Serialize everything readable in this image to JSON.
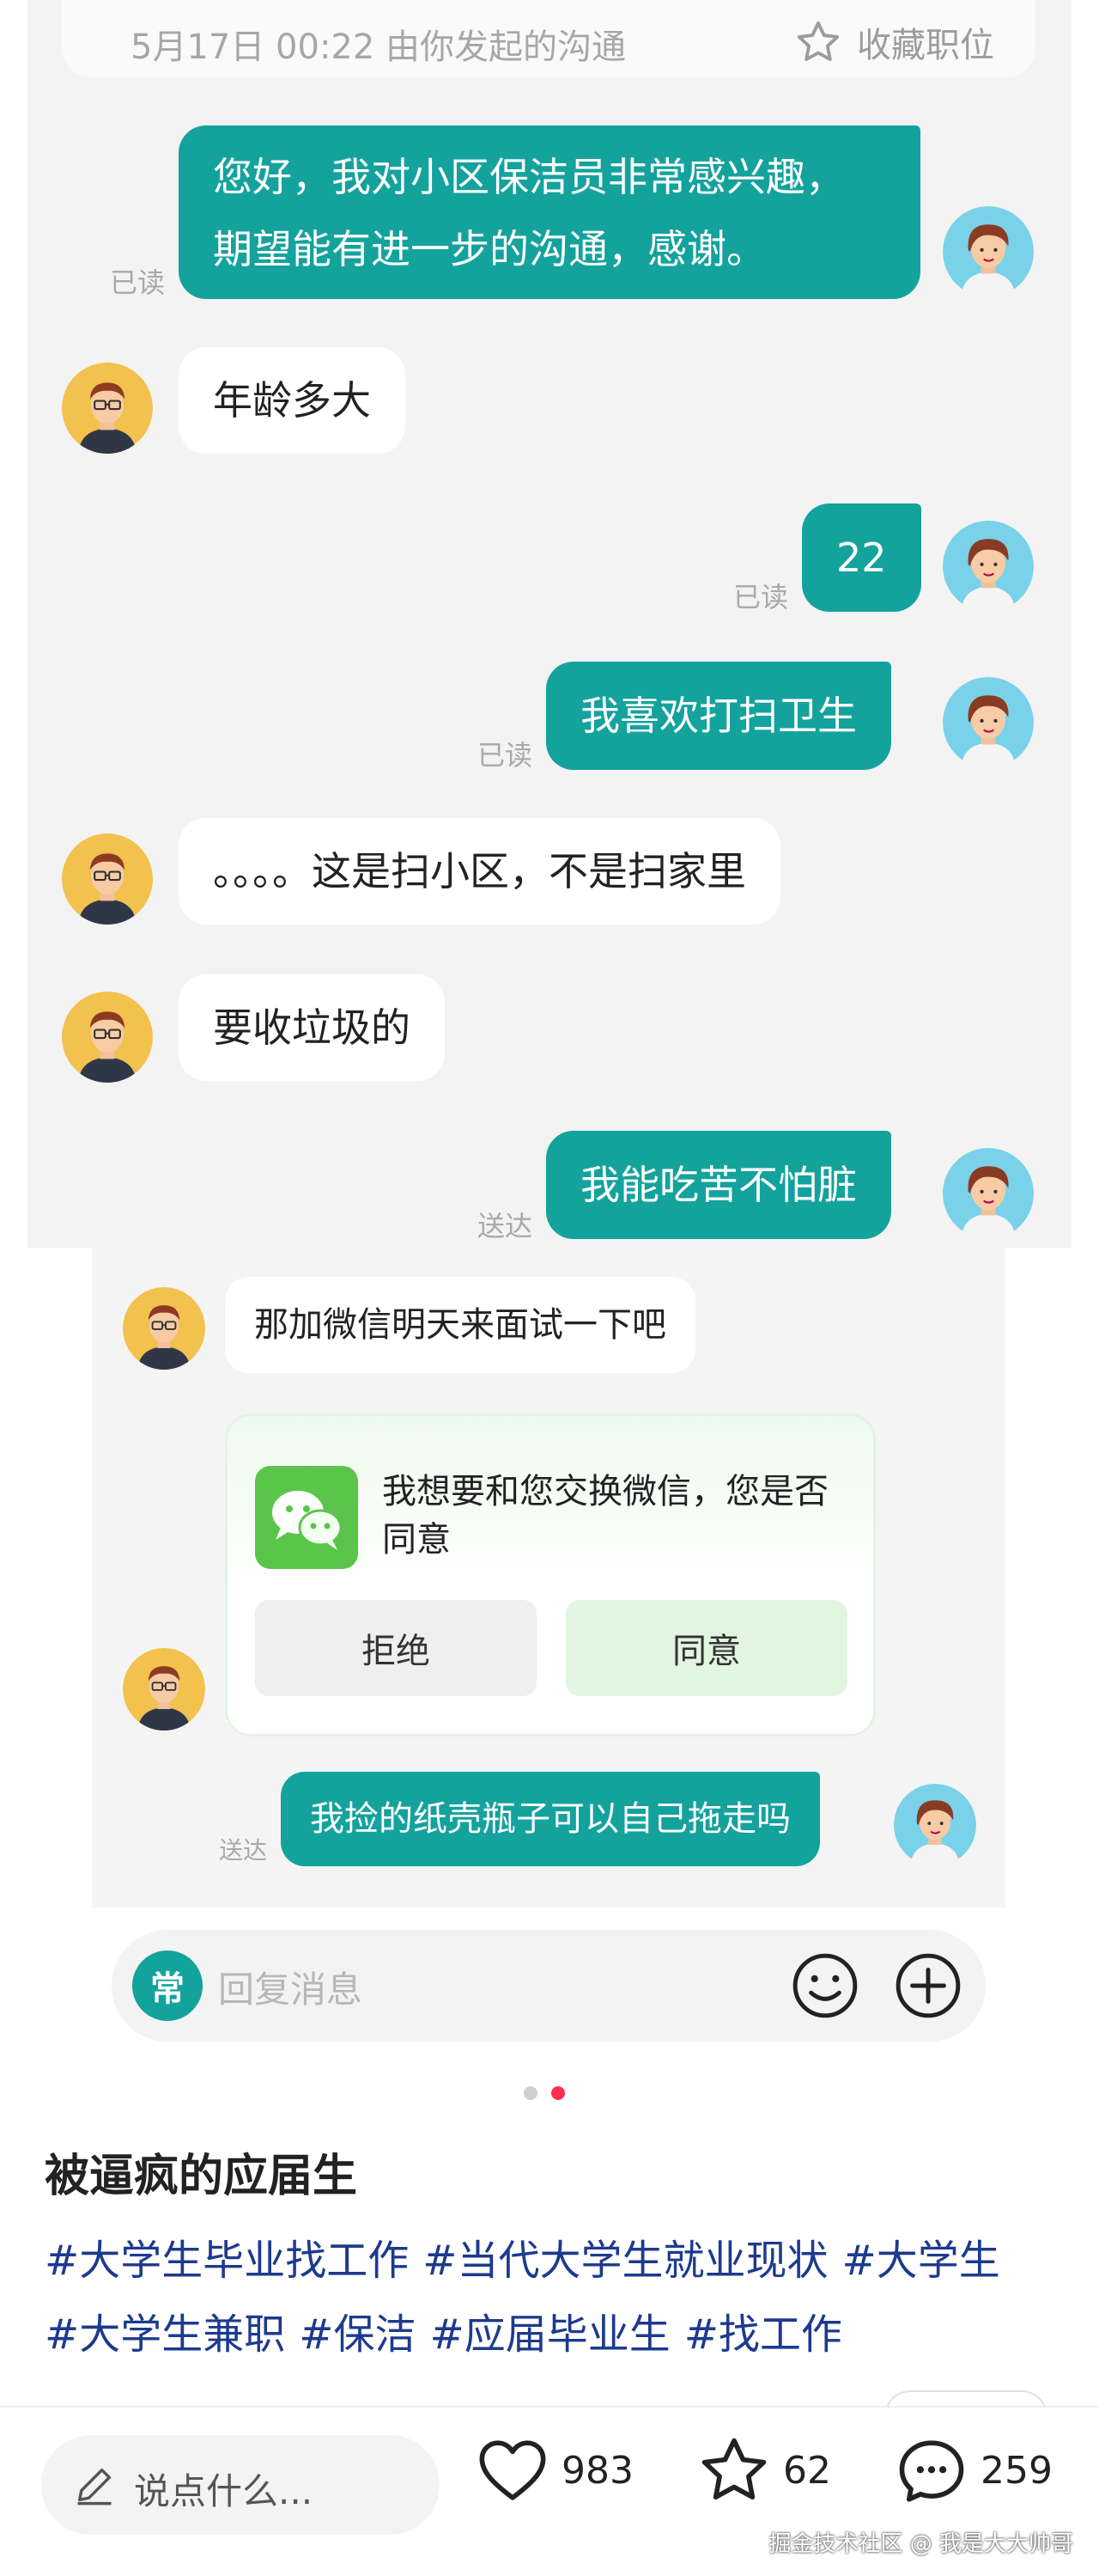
{
  "chat_header": {
    "text": "5月17日 00:22 由你发起的沟通",
    "favorite_label": "收藏职位"
  },
  "messages": [
    {
      "from": "me",
      "lines": [
        "您好，我对小区保洁员非常感兴趣，",
        "期望能有进一步的沟通，感谢。"
      ],
      "status": "已读"
    },
    {
      "from": "them",
      "text": "年龄多大"
    },
    {
      "from": "me",
      "text": "22",
      "status": "已读"
    },
    {
      "from": "me",
      "text": "我喜欢打扫卫生",
      "status": "已读"
    },
    {
      "from": "them",
      "text": "。。。。这是扫小区，不是扫家里"
    },
    {
      "from": "them",
      "text": "要收垃圾的"
    },
    {
      "from": "me",
      "text": "我能吃苦不怕脏",
      "status": "送达"
    }
  ],
  "messages2": [
    {
      "from": "them",
      "text": "那加微信明天来面试一下吧"
    },
    {
      "from": "me",
      "text": "我捡的纸壳瓶子可以自己拖走吗",
      "status": "送达"
    }
  ],
  "wechat_card": {
    "text": "我想要和您交换微信，您是否同意",
    "reject": "拒绝",
    "agree": "同意"
  },
  "reply_bar": {
    "chang": "常",
    "placeholder": "回复消息"
  },
  "post": {
    "title": "被逼疯的应届生",
    "tags": [
      "#大学生毕业找工作",
      "#当代大学生就业现状",
      "#大学生",
      "#大学生兼职",
      "#保洁",
      "#应届毕业生",
      "#找工作"
    ]
  },
  "bottom_bar": {
    "comment_placeholder": "说点什么...",
    "likes": "983",
    "stars": "62",
    "comments": "259"
  },
  "watermark": "掘金技术社区 @ 我是大大帅哥",
  "colors": {
    "accent": "#14a29d",
    "tag": "#1d3a8e",
    "active_dot": "#ff2e4d",
    "wechat_green": "#5ac54a"
  },
  "icons": [
    "star-icon",
    "smiley-icon",
    "plus-icon",
    "pencil-icon",
    "heart-icon",
    "comment-icon",
    "wechat-icon"
  ]
}
